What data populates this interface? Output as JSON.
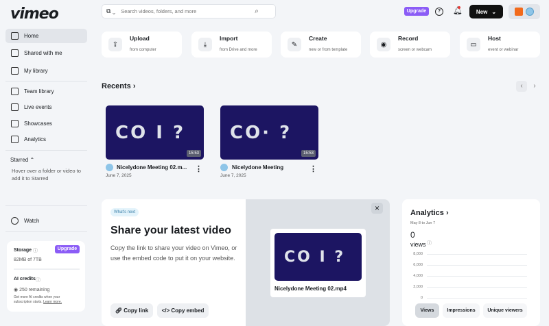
{
  "brand": "vimeo",
  "search": {
    "placeholder": "Search videos, folders, and more"
  },
  "header": {
    "upgrade": "Upgrade",
    "new": "New"
  },
  "sidebar": {
    "items": [
      {
        "label": "Home"
      },
      {
        "label": "Shared with me"
      },
      {
        "label": "My library"
      },
      {
        "label": "Team library"
      },
      {
        "label": "Live events"
      },
      {
        "label": "Showcases"
      },
      {
        "label": "Analytics"
      }
    ],
    "starred": "Starred",
    "starred_hint": "Hover over a folder or video to add it to Starred",
    "watch": "Watch"
  },
  "storage": {
    "title": "Storage",
    "upgrade": "Upgrade",
    "used": "82MB of 7TB",
    "ai_title": "AI credits",
    "ai_remaining": "250 remaining",
    "ai_note": "Get more AI credits when your subscription starts.",
    "learn_more": "Learn more."
  },
  "actions": [
    {
      "title": "Upload",
      "sub": "from computer",
      "icon": "upload-icon"
    },
    {
      "title": "Import",
      "sub": "from Drive and more",
      "icon": "import-icon"
    },
    {
      "title": "Create",
      "sub": "new or from template",
      "icon": "create-icon"
    },
    {
      "title": "Record",
      "sub": "screen or webcam",
      "icon": "record-icon"
    },
    {
      "title": "Host",
      "sub": "event or webinar",
      "icon": "host-icon"
    }
  ],
  "recents": {
    "title": "Recents",
    "videos": [
      {
        "title": "Nicelydone Meeting 02.m...",
        "date": "June 7, 2025",
        "duration": "15:53",
        "thumb": "CO I ?"
      },
      {
        "title": "Nicelydone Meeting",
        "date": "June 7, 2025",
        "duration": "15:53",
        "thumb": "CO· ?"
      }
    ]
  },
  "share": {
    "badge": "What's next",
    "title": "Share your latest video",
    "body": "Copy the link to share your video on Vimeo, or use the embed code to put it on your website.",
    "copy_link": "Copy link",
    "copy_embed": "Copy embed",
    "preview_title": "Nicelydone Meeting 02.mp4",
    "preview_thumb": "CO I ?"
  },
  "analytics": {
    "title": "Analytics",
    "range": "May 8 to Jun 7",
    "count": "0",
    "unit": "views",
    "tabs": [
      "Views",
      "Impressions",
      "Unique viewers"
    ]
  },
  "chart_data": {
    "type": "line",
    "ylim": [
      0,
      8000
    ],
    "yticks": [
      "8,000",
      "6,000",
      "4,000",
      "2,000",
      "0"
    ],
    "series": [
      {
        "name": "views",
        "values": []
      }
    ]
  }
}
